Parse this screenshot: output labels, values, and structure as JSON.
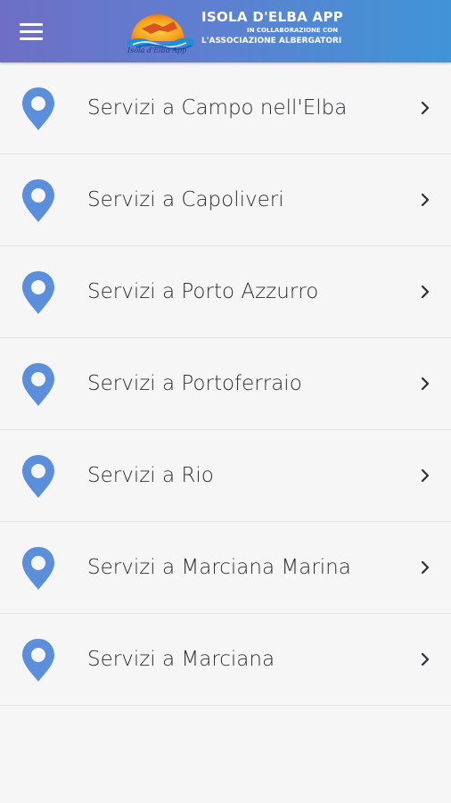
{
  "header": {
    "menu_icon": "hamburger-menu-icon",
    "logo_caption": "Isola d'Elba App",
    "title": "ISOLA D'ELBA APP",
    "subtitle_line1": "IN COLLABORAZIONE CON",
    "subtitle_line2": "L'ASSOCIAZIONE ALBERGATORI",
    "gradient_start": "#6d6fc6",
    "gradient_end": "#3f95d6"
  },
  "list": {
    "accent_color": "#5b8fdb",
    "pin_icon": "map-pin-icon",
    "chevron_icon": "chevron-right-icon",
    "items": [
      {
        "label": "Servizi a Campo nell'Elba"
      },
      {
        "label": "Servizi a Capoliveri"
      },
      {
        "label": "Servizi a Porto Azzurro"
      },
      {
        "label": "Servizi a Portoferraio"
      },
      {
        "label": "Servizi a Rio"
      },
      {
        "label": "Servizi a Marciana Marina"
      },
      {
        "label": "Servizi a Marciana"
      }
    ]
  }
}
